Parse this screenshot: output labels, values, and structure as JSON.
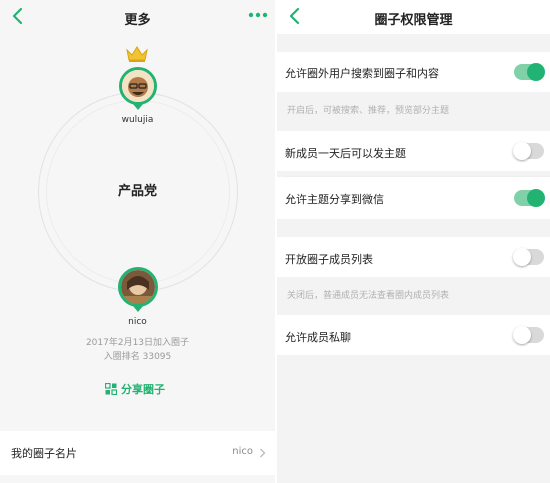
{
  "left": {
    "nav": {
      "title": "更多",
      "back_icon": "chevron-left-icon",
      "more_icon": "more-dots-icon"
    },
    "owner": {
      "name": "wulujia",
      "crown_icon": "crown-icon"
    },
    "group_name": "产品党",
    "member": {
      "name": "nico"
    },
    "join_date": "2017年2月13日加入圈子",
    "join_rank": "入圈排名 33095",
    "share_label": "分享圈子",
    "share_icon": "share-circle-icon",
    "card": {
      "label": "我的圈子名片",
      "value": "nico"
    }
  },
  "right": {
    "nav": {
      "title": "圈子权限管理",
      "back_icon": "chevron-left-icon"
    },
    "settings": [
      {
        "label": "允许圈外用户搜索到圈子和内容",
        "enabled": true,
        "hint": "开启后，可被搜索、推荐，预览部分主题"
      },
      {
        "label": "新成员一天后可以发主题",
        "enabled": false
      },
      {
        "label": "允许主题分享到微信",
        "enabled": true
      },
      {
        "label": "开放圈子成员列表",
        "enabled": false,
        "hint": "关闭后，普通成员无法查看圈内成员列表"
      },
      {
        "label": "允许成员私聊",
        "enabled": false
      }
    ]
  },
  "colors": {
    "accent": "#22b373",
    "toggle_on_track": "#7fd2a8",
    "toggle_off_track": "#d9d9d9"
  }
}
